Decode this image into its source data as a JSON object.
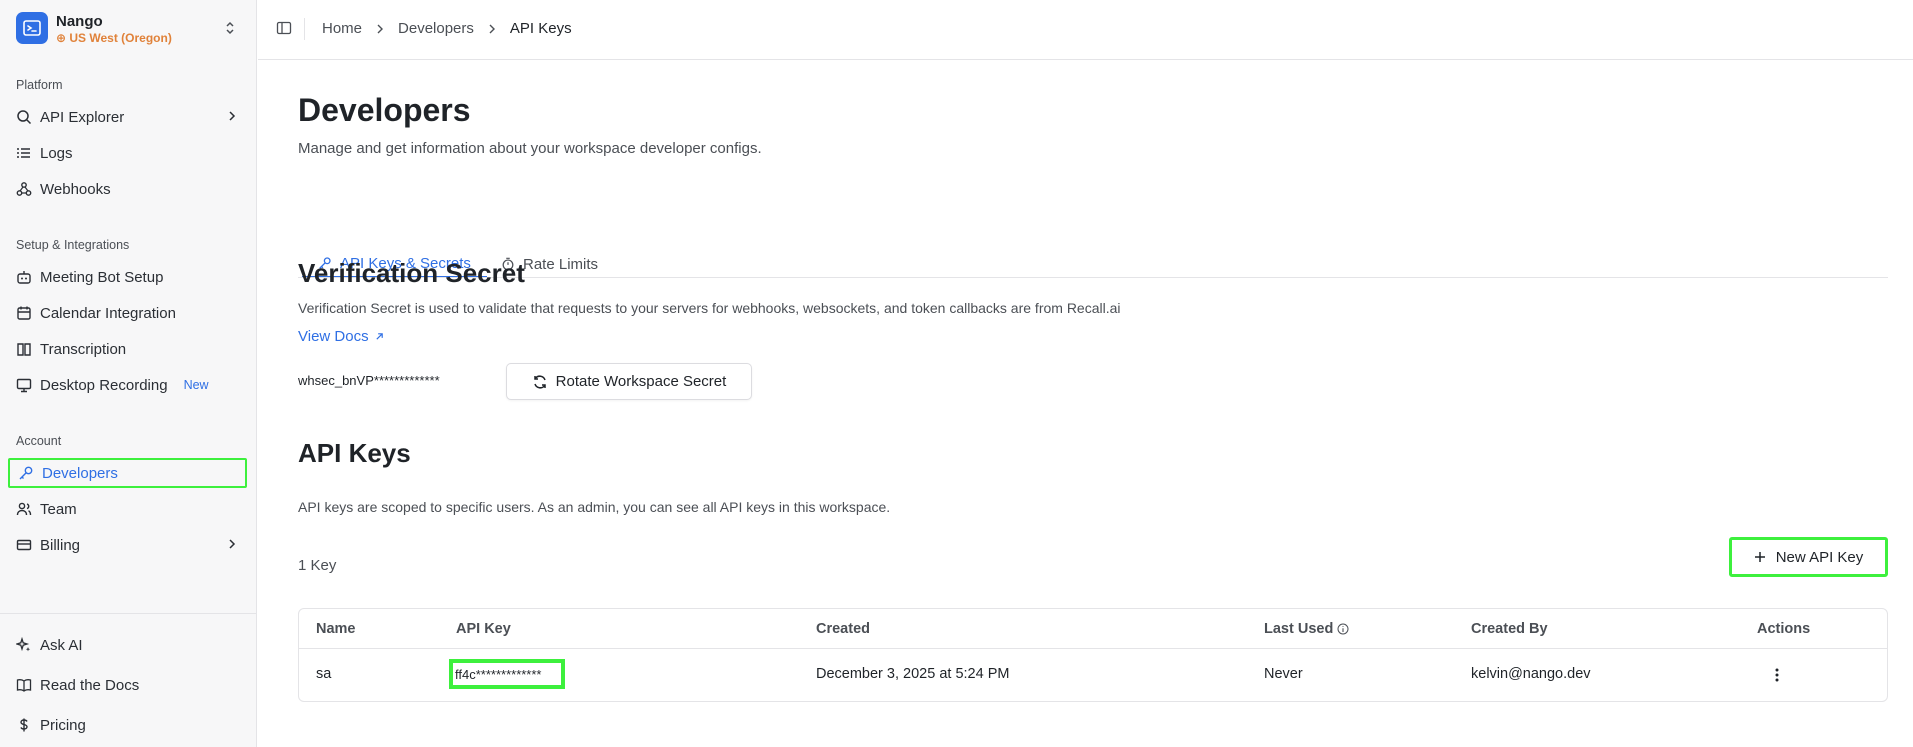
{
  "workspace": {
    "name": "Nango",
    "region": "US West (Oregon)"
  },
  "sidebar": {
    "sections": [
      {
        "label": "Platform"
      },
      {
        "label": "Setup & Integrations"
      },
      {
        "label": "Account"
      }
    ],
    "items": [
      {
        "label": "API Explorer",
        "icon": "search-icon"
      },
      {
        "label": "Logs",
        "icon": "list-icon"
      },
      {
        "label": "Webhooks",
        "icon": "webhook-icon"
      },
      {
        "label": "Meeting Bot Setup",
        "icon": "bot-icon"
      },
      {
        "label": "Calendar Integration",
        "icon": "calendar-icon"
      },
      {
        "label": "Transcription",
        "icon": "book-icon"
      },
      {
        "label": "Desktop Recording",
        "icon": "monitor-icon",
        "badge": "New"
      },
      {
        "label": "Developers",
        "icon": "key-icon"
      },
      {
        "label": "Team",
        "icon": "users-icon"
      },
      {
        "label": "Billing",
        "icon": "card-icon"
      }
    ],
    "bottom": [
      {
        "label": "Ask AI",
        "icon": "sparkles-icon"
      },
      {
        "label": "Read the Docs",
        "icon": "book-open-icon"
      },
      {
        "label": "Pricing",
        "icon": "dollar-icon"
      }
    ]
  },
  "breadcrumb": [
    "Home",
    "Developers",
    "API Keys"
  ],
  "page": {
    "title": "Developers",
    "subtitle": "Manage and get information about your workspace developer configs."
  },
  "tabs": [
    {
      "label": "API Keys & Secrets",
      "icon": "key-icon"
    },
    {
      "label": "Rate Limits",
      "icon": "timer-icon"
    }
  ],
  "verification": {
    "title": "Verification Secret",
    "description": "Verification Secret is used to validate that requests to your servers for webhooks, websockets, and token callbacks are from Recall.ai",
    "docs_link": "View Docs",
    "secret_value": "whsec_bnVP*************",
    "rotate_label": "Rotate Workspace Secret"
  },
  "api_keys": {
    "title": "API Keys",
    "description": "API keys are scoped to specific users. As an admin, you can see all API keys in this workspace.",
    "count_label": "1 Key",
    "new_button": "New API Key",
    "columns": [
      "Name",
      "API Key",
      "Created",
      "Last Used",
      "Created By",
      "Actions"
    ],
    "rows": [
      {
        "name": "sa",
        "key": "ff4c*************",
        "created": "December 3, 2025 at 5:24 PM",
        "last_used": "Never",
        "created_by": "kelvin@nango.dev"
      }
    ]
  },
  "colors": {
    "accent": "#2f6fe4",
    "region": "#e0823a",
    "highlight": "#3df03d"
  }
}
